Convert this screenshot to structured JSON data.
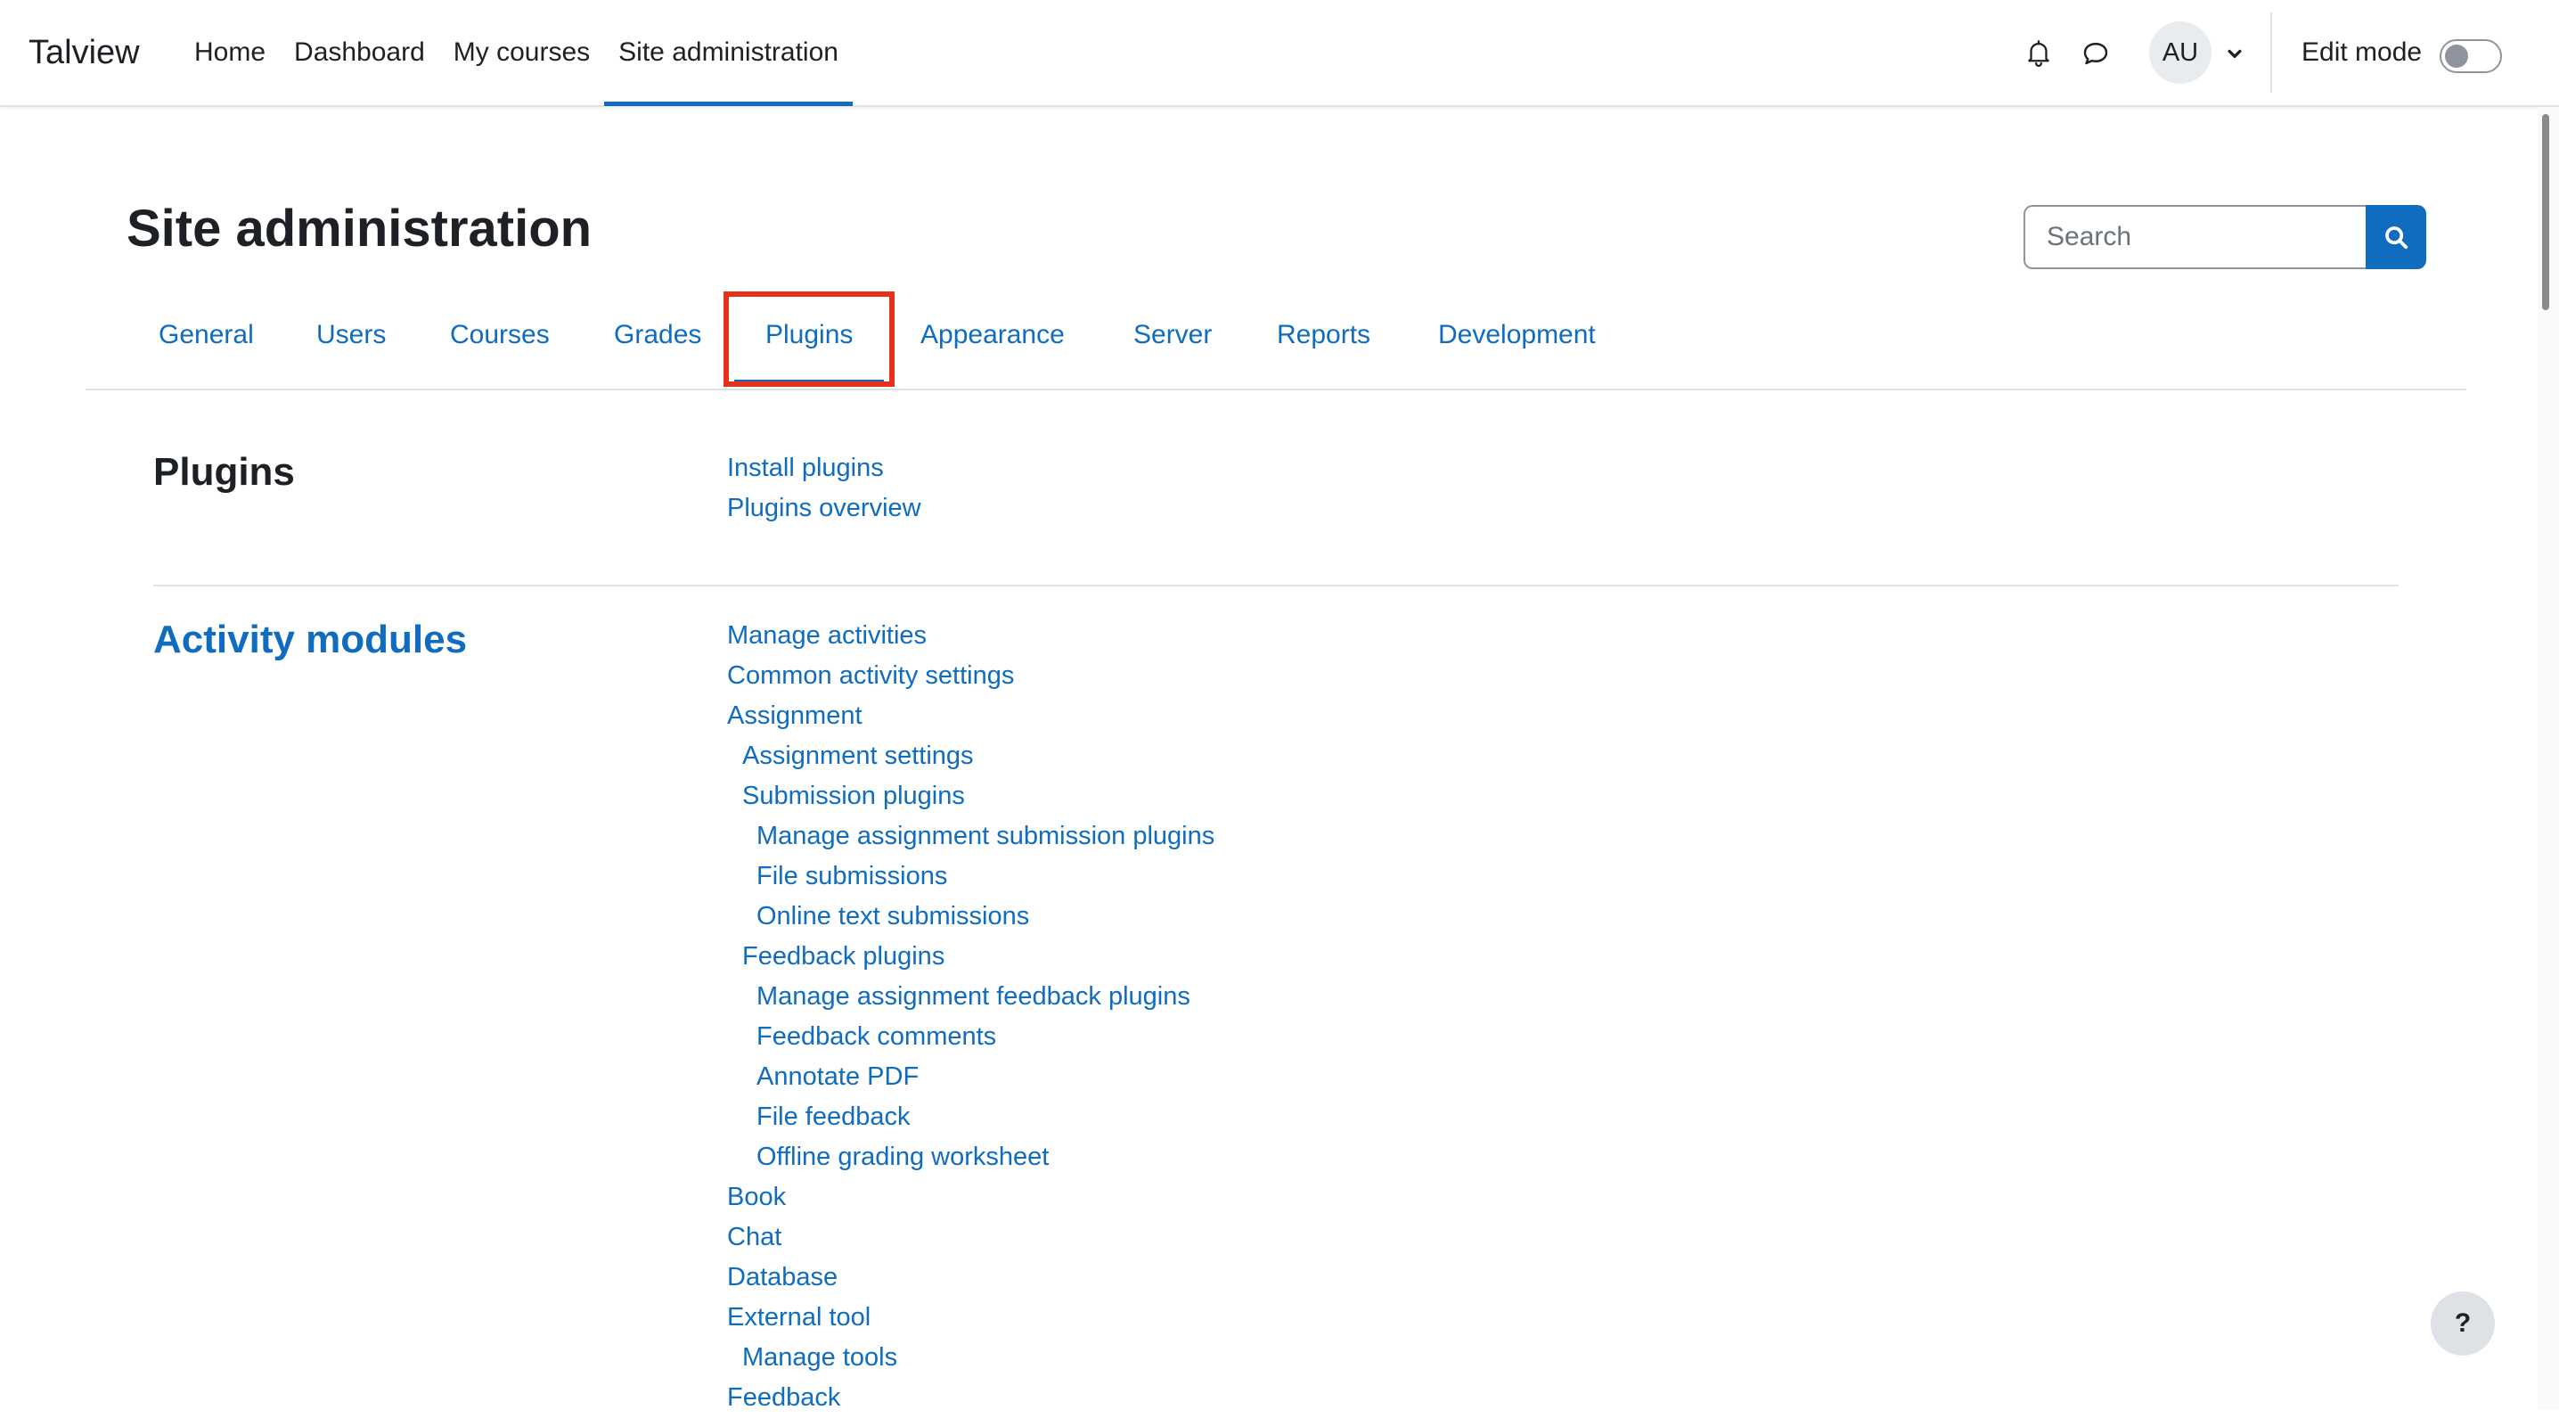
{
  "brand": "Talview",
  "nav": {
    "items": [
      {
        "label": "Home",
        "active": false
      },
      {
        "label": "Dashboard",
        "active": false
      },
      {
        "label": "My courses",
        "active": false
      },
      {
        "label": "Site administration",
        "active": true
      }
    ],
    "avatar_initials": "AU",
    "edit_mode_label": "Edit mode",
    "edit_mode_on": false
  },
  "page": {
    "title": "Site administration",
    "search_placeholder": "Search"
  },
  "tabs": {
    "items": [
      "General",
      "Users",
      "Courses",
      "Grades",
      "Plugins",
      "Appearance",
      "Server",
      "Reports",
      "Development"
    ],
    "active": "Plugins"
  },
  "sections": {
    "plugins": {
      "title": "Plugins",
      "links": [
        "Install plugins",
        "Plugins overview"
      ]
    },
    "activity_modules": {
      "title": "Activity modules",
      "links": [
        {
          "label": "Manage activities",
          "level": 0
        },
        {
          "label": "Common activity settings",
          "level": 0
        },
        {
          "label": "Assignment",
          "level": 0
        },
        {
          "label": "Assignment settings",
          "level": 1
        },
        {
          "label": "Submission plugins",
          "level": 1
        },
        {
          "label": "Manage assignment submission plugins",
          "level": 2
        },
        {
          "label": "File submissions",
          "level": 2
        },
        {
          "label": "Online text submissions",
          "level": 2
        },
        {
          "label": "Feedback plugins",
          "level": 1
        },
        {
          "label": "Manage assignment feedback plugins",
          "level": 2
        },
        {
          "label": "Feedback comments",
          "level": 2
        },
        {
          "label": "Annotate PDF",
          "level": 2
        },
        {
          "label": "File feedback",
          "level": 2
        },
        {
          "label": "Offline grading worksheet",
          "level": 2
        },
        {
          "label": "Book",
          "level": 0
        },
        {
          "label": "Chat",
          "level": 0
        },
        {
          "label": "Database",
          "level": 0
        },
        {
          "label": "External tool",
          "level": 0
        },
        {
          "label": "Manage tools",
          "level": 1
        },
        {
          "label": "Feedback",
          "level": 0
        }
      ]
    }
  },
  "help_label": "?",
  "icons": {
    "notifications": "bell-icon",
    "messages": "chat-bubble-icon",
    "avatar_menu": "chevron-down-icon",
    "search": "search-icon"
  },
  "colors": {
    "accent": "#0f6cbf",
    "highlight": "#e8311a",
    "text": "#1d2125"
  }
}
